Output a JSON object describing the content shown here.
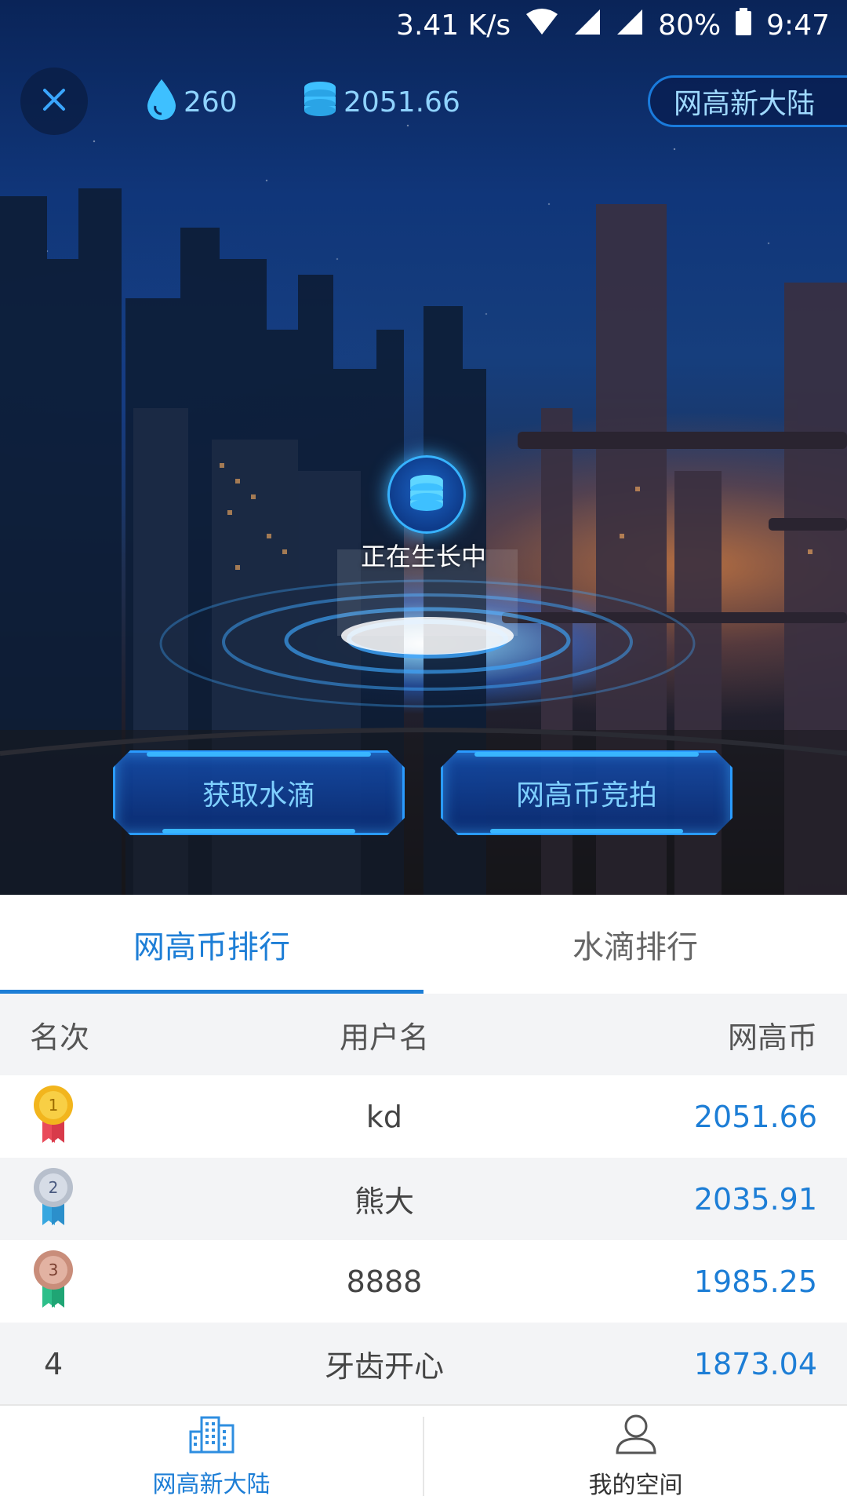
{
  "status_bar": {
    "speed": "3.41 K/s",
    "battery": "80%",
    "time": "9:47"
  },
  "top_bar": {
    "close_icon": "close-icon",
    "drops_value": "260",
    "coins_value": "2051.66",
    "realm_button": "网高新大陆"
  },
  "orb": {
    "label": "正在生长中"
  },
  "actions": {
    "get_drops": "获取水滴",
    "coin_auction": "网高币竞拍"
  },
  "tabs": [
    {
      "label": "网高币排行",
      "active": true
    },
    {
      "label": "水滴排行",
      "active": false
    }
  ],
  "table": {
    "headers": {
      "rank": "名次",
      "username": "用户名",
      "coins": "网高币"
    },
    "rows": [
      {
        "rank": "1",
        "username": "kd",
        "coins": "2051.66",
        "medal": "gold"
      },
      {
        "rank": "2",
        "username": "熊大",
        "coins": "2035.91",
        "medal": "silver"
      },
      {
        "rank": "3",
        "username": "8888",
        "coins": "1985.25",
        "medal": "bronze"
      },
      {
        "rank": "4",
        "username": "牙齿开心",
        "coins": "1873.04",
        "medal": ""
      }
    ]
  },
  "bottom_nav": [
    {
      "label": "网高新大陆",
      "icon": "buildings-icon",
      "active": true
    },
    {
      "label": "我的空间",
      "icon": "user-icon",
      "active": false
    }
  ],
  "colors": {
    "accent": "#1d7ed6",
    "medal_gold": "#f2b51d",
    "medal_silver": "#b7bfcc",
    "medal_bronze": "#c98d7a"
  }
}
